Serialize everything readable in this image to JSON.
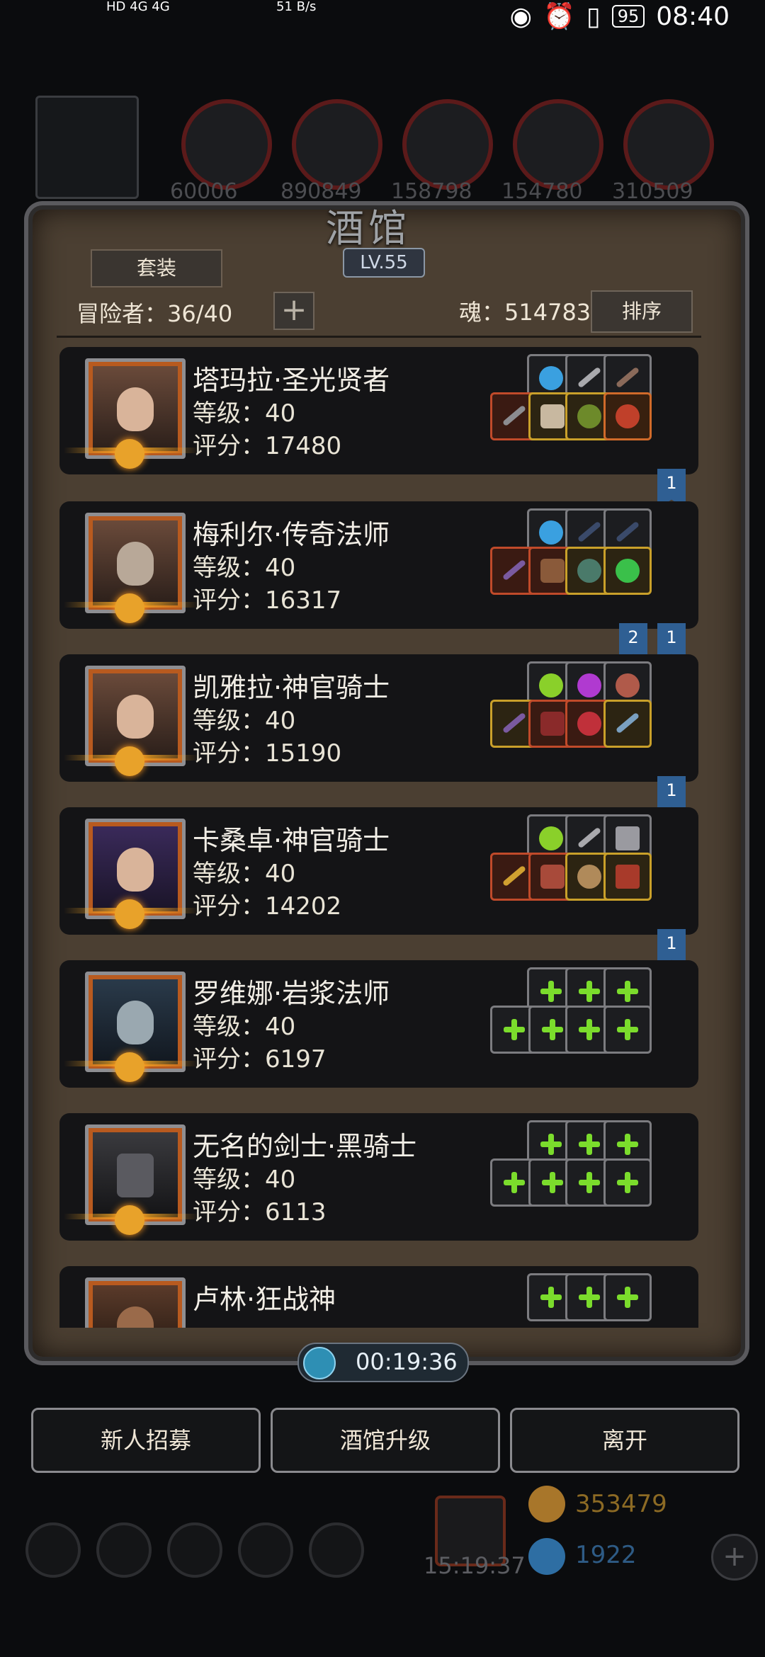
{
  "status_bar": {
    "net_left": "HD 4G 4G",
    "speed": "51 B/s",
    "battery": "95",
    "time": "08:40"
  },
  "background_bar": {
    "resources": [
      "60006",
      "890849",
      "158798",
      "154780",
      "310509"
    ]
  },
  "tavern": {
    "title": "酒馆",
    "level": "LV.55",
    "suit_button": "套装",
    "adventurers": "冒险者：36/40",
    "soul": "魂：514783",
    "sort_button": "排序",
    "timer": "00:19:36"
  },
  "heroes": [
    {
      "name": "塔玛拉·圣光贤者",
      "level": "等级：40",
      "score": "评分：17480",
      "flags": [
        "1"
      ]
    },
    {
      "name": "梅利尔·传奇法师",
      "level": "等级：40",
      "score": "评分：16317",
      "flags": [
        "2",
        "1"
      ]
    },
    {
      "name": "凯雅拉·神官骑士",
      "level": "等级：40",
      "score": "评分：15190",
      "flags": [
        "1"
      ]
    },
    {
      "name": "卡桑卓·神官骑士",
      "level": "等级：40",
      "score": "评分：14202",
      "flags": [
        "1"
      ]
    },
    {
      "name": "罗维娜·岩浆法师",
      "level": "等级：40",
      "score": "评分：6197",
      "flags": []
    },
    {
      "name": "无名的剑士·黑骑士",
      "level": "等级：40",
      "score": "评分：6113",
      "flags": []
    },
    {
      "name": "卢林·狂战神",
      "level": "",
      "score": "",
      "flags": []
    }
  ],
  "buttons": {
    "recruit": "新人招募",
    "upgrade": "酒馆升级",
    "leave": "离开"
  },
  "bottom_bar": {
    "gift_timer": "15:19:37",
    "gold": "353479",
    "gems": "1922"
  },
  "colors": {
    "add_slot": "#7bdc2c",
    "flag": "#2f5f93",
    "panel": "#4b3f32"
  }
}
